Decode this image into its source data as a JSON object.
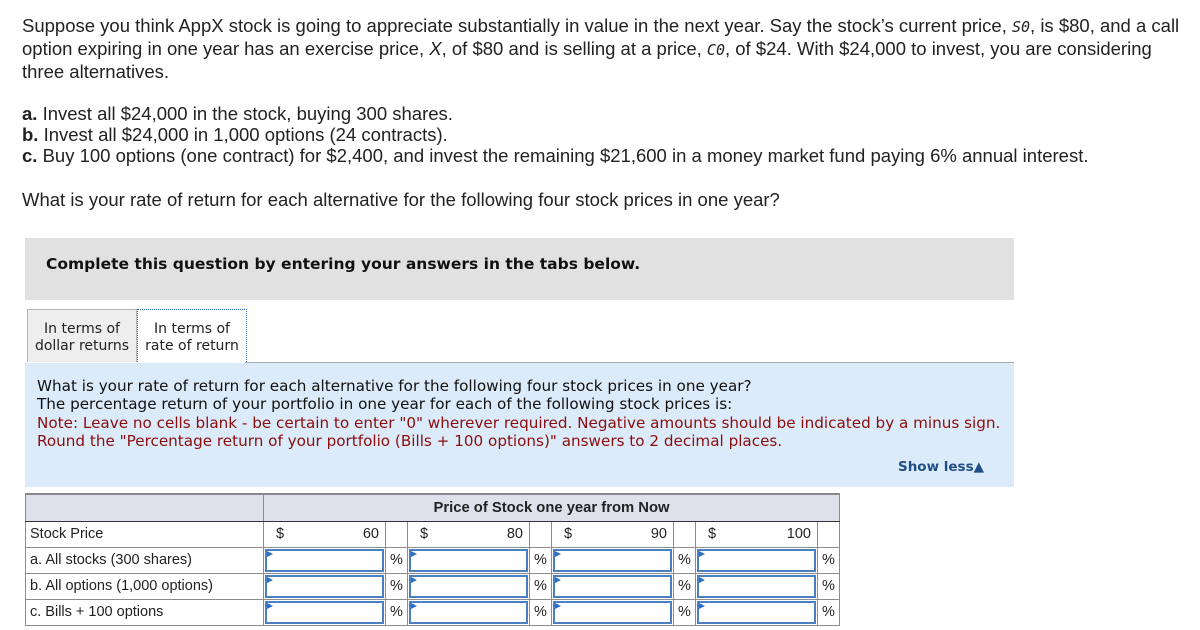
{
  "intro": {
    "part1": "Suppose you think AppX stock is going to appreciate substantially in value in the next year. Say the stock’s current price, ",
    "s0": "S",
    "s0_sub": "0",
    "part2": ", is $80, and a call option expiring in one year has an exercise price, ",
    "x": "X",
    "part3": ", of $80 and is selling at a price, ",
    "c0": "C",
    "c0_sub": "0",
    "part4": ", of $24. With $24,000 to invest, you are considering three alternatives."
  },
  "alternatives": [
    {
      "letter": "a.",
      "text": " Invest all $24,000 in the stock, buying 300 shares."
    },
    {
      "letter": "b.",
      "text": " Invest all $24,000 in 1,000 options (24 contracts)."
    },
    {
      "letter": "c.",
      "text": " Buy 100 options (one contract) for $2,400, and invest the remaining $21,600 in a money market fund paying 6% annual interest."
    }
  ],
  "question": "What is your rate of return for each alternative for the following four stock prices in one year?",
  "banner": "Complete this question by entering your answers in the tabs below.",
  "tabs": [
    {
      "line1": "In terms of",
      "line2": "dollar returns",
      "active": false
    },
    {
      "line1": "In terms of",
      "line2": "rate of return",
      "active": true
    }
  ],
  "info": {
    "line1": "What is your rate of return for each alternative for the following four stock prices in one year?",
    "line2": "The percentage return of your portfolio in one year for each of the following stock prices is:",
    "note1": "Note: Leave no cells blank - be certain to enter \"0\" wherever required. Negative amounts should be indicated by a minus sign.",
    "note2": "Round the \"Percentage return of your portfolio (Bills + 100 options)\" answers to 2 decimal places.",
    "show_less": "Show less",
    "show_less_icon": "▲"
  },
  "table": {
    "header": "Price of Stock one year from Now",
    "stock_price_label": "Stock Price",
    "currency": "$",
    "percent": "%",
    "prices": [
      "60",
      "80",
      "90",
      "100"
    ],
    "rows": [
      {
        "label": "a. All stocks (300 shares)",
        "values": [
          "",
          "",
          "",
          ""
        ]
      },
      {
        "label": "b. All options (1,000 options)",
        "values": [
          "",
          "",
          "",
          ""
        ]
      },
      {
        "label": "c. Bills + 100 options",
        "values": [
          "",
          "",
          "",
          ""
        ]
      }
    ]
  }
}
